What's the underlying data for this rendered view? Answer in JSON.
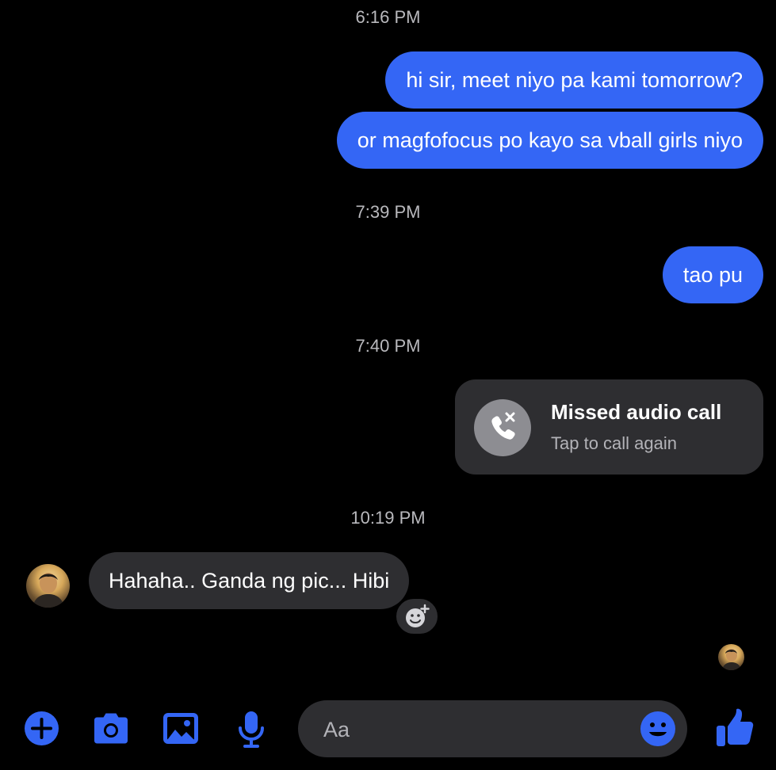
{
  "thread": {
    "timestamps": [
      "6:16 PM",
      "7:39 PM",
      "7:40 PM",
      "10:19 PM"
    ],
    "outgoing": [
      "hi sir, meet niyo pa kami tomorrow?",
      "or magfofocus po kayo sa vball girls niyo",
      "tao pu"
    ],
    "missed_call": {
      "title": "Missed audio call",
      "subtitle": "Tap to call again"
    },
    "incoming": {
      "text": "Hahaha.. Ganda ng pic... Hibi"
    }
  },
  "composer": {
    "placeholder": "Aa"
  },
  "icons": {
    "add": "plus-circle-icon",
    "camera": "camera-icon",
    "gallery": "image-icon",
    "voice": "microphone-icon",
    "emoji": "smiley-icon",
    "like": "thumbs-up-icon",
    "react": "add-reaction-icon",
    "call": "missed-call-icon"
  },
  "colors": {
    "accent": "#3466f5",
    "bubble_incoming": "#2e2e31",
    "background": "#000000"
  }
}
